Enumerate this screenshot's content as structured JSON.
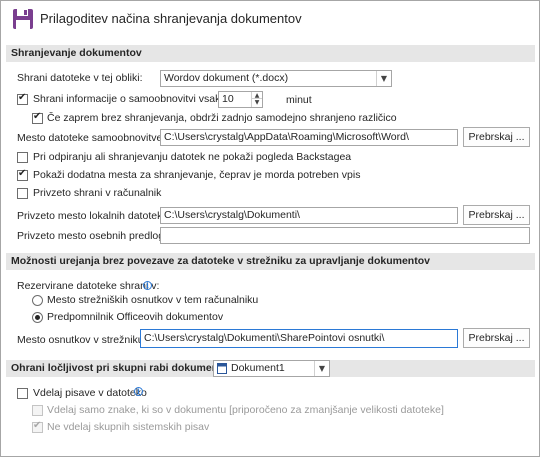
{
  "header": {
    "title": "Prilagoditev načina shranjevanja dokumentov",
    "icon": "save-floppy-icon"
  },
  "save": {
    "section_title": "Shranjevanje dokumentov",
    "format_label": "Shrani datoteke v tej obliki:",
    "format_value": "Wordov dokument (*.docx)",
    "autorecover_label": "Shrani informacije o samoobnovitvi vsakih",
    "autorecover_checked": true,
    "autorecover_minutes": "10",
    "autorecover_unit": "minut",
    "keep_last_label": "Če zaprem brez shranjevanja, obdrži zadnjo samodejno shranjeno različico",
    "keep_last_checked": true,
    "autorecover_location_label": "Mesto datoteke samoobnovitve:",
    "autorecover_location_value": "C:\\Users\\crystalg\\AppData\\Roaming\\Microsoft\\Word\\",
    "browse_label": "Prebrskaj ...",
    "no_backstage_label": "Pri odpiranju ali shranjevanju datotek ne pokaži pogleda Backstagea",
    "no_backstage_checked": false,
    "show_additional_label": "Pokaži dodatna mesta za shranjevanje, čeprav je morda potreben vpis",
    "show_additional_checked": true,
    "save_local_label": "Privzeto shrani v računalnik",
    "save_local_checked": false,
    "default_local_label": "Privzeto mesto lokalnih datotek:",
    "default_local_value": "C:\\Users\\crystalg\\Dokumenti\\",
    "browse_label2": "Prebrskaj ...",
    "default_personal_label": "Privzeto mesto osebnih predlog:",
    "default_personal_value": ""
  },
  "offline": {
    "section_title": "Možnosti urejanja brez povezave za datoteke v strežniku za upravljanje dokumentov",
    "save_checked_out_label": "Rezervirane datoteke shrani v:",
    "option_server_label": "Mesto strežniških osnutkov v tem računalniku",
    "option_server_checked": false,
    "option_cache_label": "Predpomnilnik Officeovih dokumentov",
    "option_cache_checked": true,
    "drafts_location_label": "Mesto osnutkov v strežniku:",
    "drafts_location_value": "C:\\Users\\crystalg\\Dokumenti\\SharePointovi osnutki\\",
    "browse_label3": "Prebrskaj ..."
  },
  "fidelity": {
    "section_title": "Ohrani ločljivost pri skupni rabi dokumenta:",
    "document_value": "Dokument1",
    "embed_fonts_label": "Vdelaj pisave v datoteko",
    "embed_fonts_checked": false,
    "embed_used_chars_label": "Vdelaj samo znake, ki so v dokumentu [priporočeno za zmanjšanje velikosti datoteke]",
    "embed_used_chars_checked": false,
    "no_common_fonts_label": "Ne vdelaj skupnih sistemskih pisav",
    "no_common_fonts_checked": true
  }
}
